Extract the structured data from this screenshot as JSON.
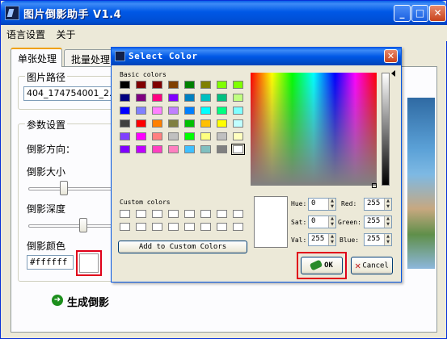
{
  "app": {
    "title": "图片倒影助手 V1.4",
    "window_controls": {
      "minimize": "_",
      "maximize": "□",
      "close": "✕"
    }
  },
  "menu": [
    "语言设置",
    "关于"
  ],
  "tabs": [
    {
      "label": "单张处理",
      "active": true
    },
    {
      "label": "批量处理",
      "active": false
    }
  ],
  "image_path": {
    "group_title": "图片路径",
    "value": "404_174754001_2.jp"
  },
  "params": {
    "group_title": "参数设置",
    "direction_label": "倒影方向：",
    "size_label": "倒影大小",
    "depth_label": "倒影深度",
    "color_label": "倒影颜色",
    "color_value": "#ffffff",
    "size_slider_fraction": 0.38,
    "depth_slider_fraction": 0.62
  },
  "generate": {
    "label": "生成倒影",
    "icon": "arrow-right-circle-icon"
  },
  "dialog": {
    "title": "Select Color",
    "close": "✕",
    "basic_colors_label": "Basic colors",
    "custom_colors_label": "Custom colors",
    "basic_colors": [
      "#000000",
      "#800000",
      "#800000",
      "#804000",
      "#008000",
      "#808000",
      "#80ff00",
      "#80ff00",
      "#000080",
      "#800080",
      "#ff0080",
      "#8000ff",
      "#0080c0",
      "#00c0c0",
      "#00c080",
      "#c0ff80",
      "#0000ff",
      "#8080ff",
      "#ff80ff",
      "#c080ff",
      "#0080ff",
      "#00ffff",
      "#00ff80",
      "#80ffff",
      "#404040",
      "#ff0000",
      "#ff8000",
      "#808040",
      "#00c000",
      "#ffc000",
      "#ffff00",
      "#c0ffff",
      "#8040ff",
      "#ff00ff",
      "#ff8080",
      "#c0c0c0",
      "#00ff00",
      "#ffff80",
      "#c0c0c0",
      "#ffffc0",
      "#8000ff",
      "#c000ff",
      "#ff40c0",
      "#ff80c0",
      "#40c0ff",
      "#80c0c0",
      "#808080",
      "#ffffff"
    ],
    "add_custom_label": "Add to Custom Colors",
    "hue_label": "Hue:",
    "sat_label": "Sat:",
    "val_label": "Val:",
    "red_label": "Red:",
    "green_label": "Green:",
    "blue_label": "Blue:",
    "hue": "0",
    "sat": "0",
    "val": "255",
    "red": "255",
    "green": "255",
    "blue": "255",
    "ok_label": "OK",
    "cancel_label": "Cancel"
  },
  "colors": {
    "titlebar": "#0058e6",
    "highlight_box": "#e0001a",
    "selected_color": "#ffffff"
  }
}
